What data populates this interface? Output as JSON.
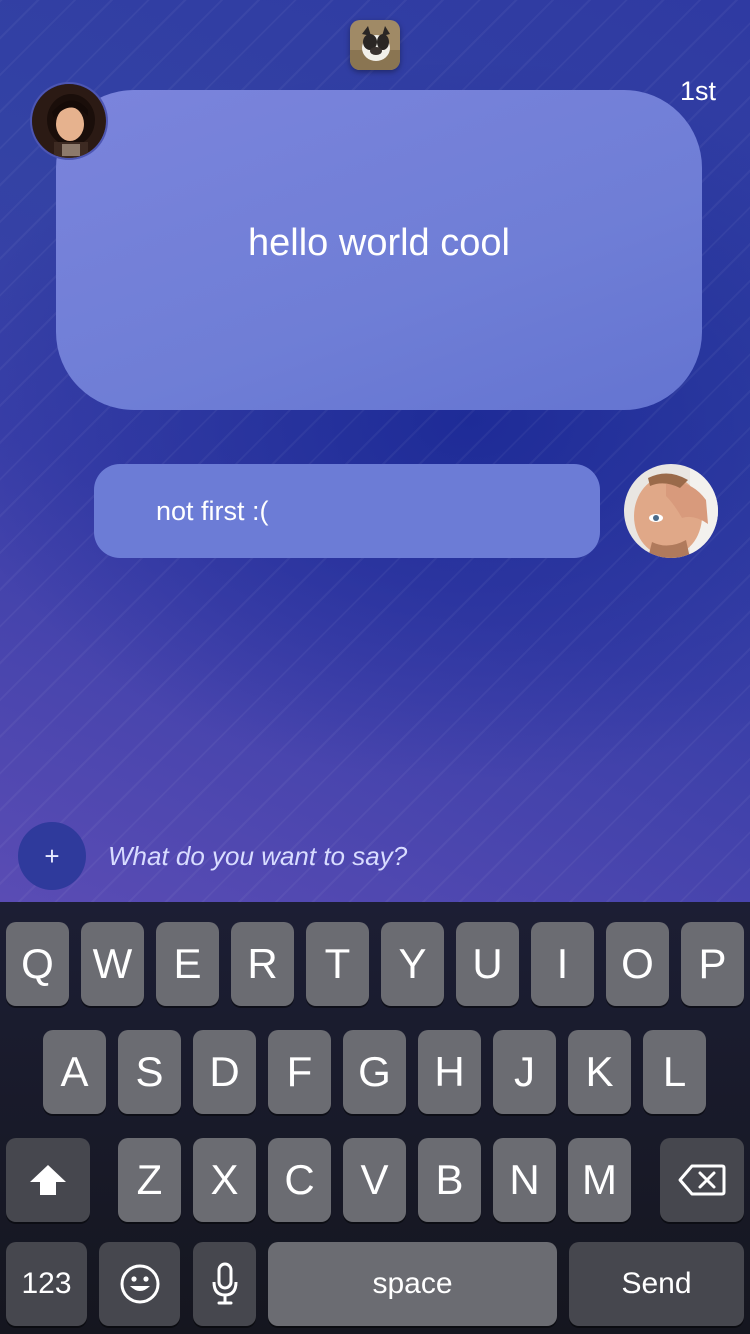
{
  "chat": {
    "rank_label": "1st",
    "messages": [
      {
        "text": "hello world cool"
      },
      {
        "text": "not first :("
      }
    ]
  },
  "compose": {
    "add_label": "+",
    "placeholder": "What do you want to say?"
  },
  "keyboard": {
    "row1": [
      "Q",
      "W",
      "E",
      "R",
      "T",
      "Y",
      "U",
      "I",
      "O",
      "P"
    ],
    "row2": [
      "A",
      "S",
      "D",
      "F",
      "G",
      "H",
      "J",
      "K",
      "L"
    ],
    "row3": [
      "Z",
      "X",
      "C",
      "V",
      "B",
      "N",
      "M"
    ],
    "numbers_label": "123",
    "space_label": "space",
    "send_label": "Send",
    "icons": {
      "shift": "shift-arrow-icon",
      "delete": "backspace-icon",
      "emoji": "emoji-face-icon",
      "mic": "microphone-icon"
    }
  },
  "colors": {
    "bubble": "#6f7ed6",
    "background_top": "#2f3aa2",
    "background_bottom": "#5a4cb4",
    "key": "#6b6c72",
    "key_dark": "#46474e"
  }
}
